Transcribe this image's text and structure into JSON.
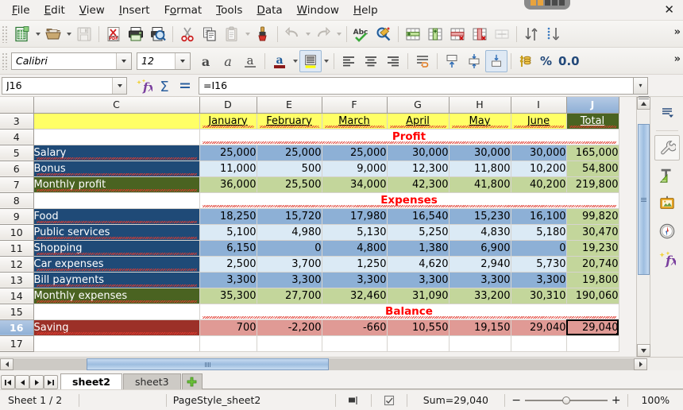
{
  "window": {
    "close_label": "✕",
    "titlebar_dots": [
      "orange",
      "orange",
      "dark",
      "dark",
      "dark"
    ]
  },
  "menubar": {
    "items": [
      {
        "label": "File",
        "accel": "F"
      },
      {
        "label": "Edit",
        "accel": "E"
      },
      {
        "label": "View",
        "accel": "V"
      },
      {
        "label": "Insert",
        "accel": "I"
      },
      {
        "label": "Format",
        "accel": "o"
      },
      {
        "label": "Tools",
        "accel": "T"
      },
      {
        "label": "Data",
        "accel": "D"
      },
      {
        "label": "Window",
        "accel": "W"
      },
      {
        "label": "Help",
        "accel": "H"
      }
    ]
  },
  "standard_toolbar": {
    "overflow_label": "»",
    "buttons": [
      {
        "name": "new-document-icon",
        "title": "New"
      },
      {
        "name": "new-dropdown-arrow",
        "title": "New dropdown"
      },
      {
        "name": "open-folder-icon",
        "title": "Open"
      },
      {
        "name": "open-dropdown-arrow",
        "title": "Open dropdown"
      },
      {
        "name": "save-icon",
        "title": "Save"
      },
      {
        "name": "export-pdf-icon",
        "title": "Export as PDF"
      },
      {
        "name": "print-icon",
        "title": "Print"
      },
      {
        "name": "print-preview-icon",
        "title": "Print Preview"
      },
      {
        "name": "cut-scissors-icon",
        "title": "Cut"
      },
      {
        "name": "copy-icon",
        "title": "Copy"
      },
      {
        "name": "paste-icon",
        "title": "Paste"
      },
      {
        "name": "paste-dropdown-arrow",
        "title": "Paste dropdown"
      },
      {
        "name": "clone-formatting-brush-icon",
        "title": "Clone Formatting"
      },
      {
        "name": "undo-icon",
        "title": "Undo"
      },
      {
        "name": "undo-dropdown-arrow",
        "title": "Undo dropdown"
      },
      {
        "name": "redo-icon",
        "title": "Redo"
      },
      {
        "name": "redo-dropdown-arrow",
        "title": "Redo dropdown"
      },
      {
        "name": "spelling-icon",
        "title": "Spelling"
      },
      {
        "name": "find-replace-icon",
        "title": "Find & Replace"
      },
      {
        "name": "insert-row-icon",
        "title": "Insert Row"
      },
      {
        "name": "insert-column-icon",
        "title": "Insert Column"
      },
      {
        "name": "delete-row-icon",
        "title": "Delete Row"
      },
      {
        "name": "delete-column-icon",
        "title": "Delete Column"
      },
      {
        "name": "merge-cells-icon",
        "title": "Merge Cells"
      },
      {
        "name": "sort-ascending-descending-icon",
        "title": "Sort"
      },
      {
        "name": "sort-descending-icon",
        "title": "Sort Descending"
      }
    ]
  },
  "format_toolbar": {
    "font_name": "Calibri",
    "font_size": "12",
    "percent_label": "%",
    "decimal_label": "0.0",
    "overflow_label": "»",
    "buttons": [
      {
        "name": "bold-icon",
        "title": "Bold"
      },
      {
        "name": "italic-icon",
        "title": "Italic"
      },
      {
        "name": "underline-icon",
        "title": "Underline"
      },
      {
        "name": "font-color-icon",
        "title": "Font Color"
      },
      {
        "name": "font-color-dropdown-arrow",
        "title": "Font Color dropdown"
      },
      {
        "name": "highlight-color-icon",
        "title": "Highlighting Color"
      },
      {
        "name": "highlight-color-dropdown-arrow",
        "title": "Highlighting dropdown"
      },
      {
        "name": "align-left-icon",
        "title": "Align Left"
      },
      {
        "name": "align-center-icon",
        "title": "Align Center"
      },
      {
        "name": "align-right-icon",
        "title": "Align Right"
      },
      {
        "name": "wrap-text-icon",
        "title": "Wrap Text"
      },
      {
        "name": "align-top-icon",
        "title": "Align Top"
      },
      {
        "name": "align-middle-icon",
        "title": "Center Vertically"
      },
      {
        "name": "align-bottom-icon",
        "title": "Align Bottom"
      },
      {
        "name": "currency-format-icon",
        "title": "Format as Currency"
      }
    ]
  },
  "formula_bar": {
    "name_box_value": "J16",
    "name_box_placeholder": "Cell reference",
    "formula_value": "=I16",
    "formula_placeholder": "Input line",
    "function_wizard_label": "fx",
    "sum_label": "Σ",
    "equals_label": "=",
    "expand_label": "▾"
  },
  "spreadsheet": {
    "columns": [
      "C",
      "D",
      "E",
      "F",
      "G",
      "H",
      "I",
      "J"
    ],
    "active_column": "J",
    "active_row": "16",
    "selected_cell": "J16",
    "rows": [
      {
        "row": "3",
        "type": "header",
        "label": "",
        "cells": [
          "January",
          "February",
          "March",
          "April",
          "May",
          "June",
          "Total"
        ]
      },
      {
        "row": "4",
        "type": "section",
        "label": "",
        "section_title": "Profit"
      },
      {
        "row": "5",
        "type": "data",
        "label": "Salary",
        "cells": [
          "25,000",
          "25,000",
          "25,000",
          "30,000",
          "30,000",
          "30,000",
          "165,000"
        ]
      },
      {
        "row": "6",
        "type": "data",
        "label": "Bonus",
        "cells": [
          "11,000",
          "500",
          "9,000",
          "12,300",
          "11,800",
          "10,200",
          "54,800"
        ]
      },
      {
        "row": "7",
        "type": "total",
        "label": "Monthly profit",
        "cells": [
          "36,000",
          "25,500",
          "34,000",
          "42,300",
          "41,800",
          "40,200",
          "219,800"
        ]
      },
      {
        "row": "8",
        "type": "section",
        "label": "",
        "section_title": "Expenses"
      },
      {
        "row": "9",
        "type": "data",
        "label": "Food",
        "cells": [
          "18,250",
          "15,720",
          "17,980",
          "16,540",
          "15,230",
          "16,100",
          "99,820"
        ]
      },
      {
        "row": "10",
        "type": "data",
        "label": "Public services",
        "cells": [
          "5,100",
          "4,980",
          "5,130",
          "5,250",
          "4,830",
          "5,180",
          "30,470"
        ]
      },
      {
        "row": "11",
        "type": "data",
        "label": "Shopping",
        "cells": [
          "6,150",
          "0",
          "4,800",
          "1,380",
          "6,900",
          "0",
          "19,230"
        ]
      },
      {
        "row": "12",
        "type": "data",
        "label": "Car expenses",
        "cells": [
          "2,500",
          "3,700",
          "1,250",
          "4,620",
          "2,940",
          "5,730",
          "20,740"
        ]
      },
      {
        "row": "13",
        "type": "data",
        "label": "Bill payments",
        "cells": [
          "3,300",
          "3,300",
          "3,300",
          "3,300",
          "3,300",
          "3,300",
          "19,800"
        ]
      },
      {
        "row": "14",
        "type": "total",
        "label": "Monthly expenses",
        "cells": [
          "35,300",
          "27,700",
          "32,460",
          "31,090",
          "33,200",
          "30,310",
          "190,060"
        ]
      },
      {
        "row": "15",
        "type": "section",
        "label": "",
        "section_title": "Balance"
      },
      {
        "row": "16",
        "type": "balance",
        "label": "Saving",
        "cells": [
          "700",
          "-2,200",
          "-660",
          "10,550",
          "19,150",
          "29,040",
          "29,040"
        ]
      },
      {
        "row": "17",
        "type": "empty",
        "label": "",
        "cells": [
          "",
          "",
          "",
          "",
          "",
          "",
          ""
        ]
      }
    ],
    "colors": {
      "header_yellow": "#ffff66",
      "label_navy": "#1f4a77",
      "label_green": "#4a6321",
      "label_red": "#9c3028",
      "data_blue_dark": "#8db0d6",
      "data_blue_light": "#dbeaf5",
      "total_green": "#c3d69b",
      "balance_pink": "#e09a95",
      "section_text_red": "#ff0000",
      "total_header_green": "#4a6321"
    }
  },
  "sidebar": {
    "items": [
      {
        "name": "sidebar-settings-icon",
        "label": "Sidebar Settings"
      },
      {
        "name": "properties-wrench-icon",
        "label": "Properties"
      },
      {
        "name": "styles-icon",
        "label": "Styles"
      },
      {
        "name": "gallery-icon",
        "label": "Gallery"
      },
      {
        "name": "navigator-compass-icon",
        "label": "Navigator"
      },
      {
        "name": "functions-fx-icon",
        "label": "Functions"
      }
    ]
  },
  "sheet_tabs": {
    "nav_first": "⏮",
    "nav_prev": "◀",
    "nav_next": "▶",
    "nav_last": "⏭",
    "add_label": "+",
    "tabs": [
      {
        "label": "sheet2",
        "active": true
      },
      {
        "label": "sheet3",
        "active": false
      }
    ]
  },
  "statusbar": {
    "sheet_count": "Sheet 1 / 2",
    "page_style": "PageStyle_sheet2",
    "selection_mode_icon": "selection-mode-icon",
    "modified_icon": "document-modified-icon",
    "sum_text": "Sum=29,040",
    "zoom_minus": "−",
    "zoom_plus": "+",
    "zoom_level": "100%"
  }
}
